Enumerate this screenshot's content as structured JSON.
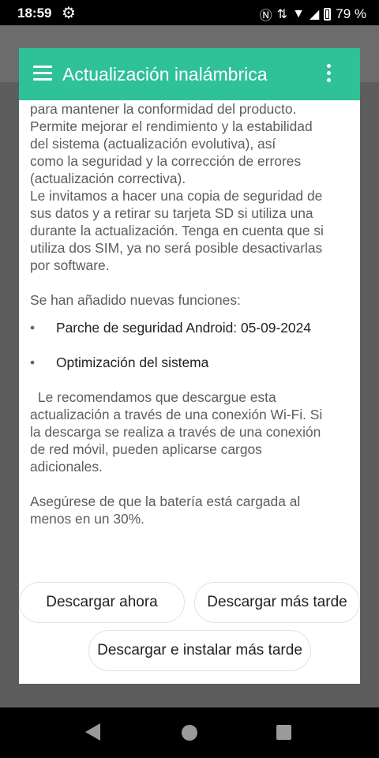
{
  "status_bar": {
    "time": "18:59",
    "battery": "79 %"
  },
  "background_app": {
    "title": ""
  },
  "dialog": {
    "title": "Actualización inalámbrica",
    "paragraphs": {
      "intro_lines": [
        "para mantener la conformidad del producto.",
        "Permite mejorar el rendimiento y la estabilidad",
        "del sistema (actualización evolutiva), así",
        "como la seguridad y la corrección de errores",
        "(actualización correctiva).",
        "Le invitamos a hacer una copia de seguridad de",
        "sus datos y a retirar su tarjeta SD si utiliza una",
        "durante la actualización. Tenga en cuenta que si",
        "utiliza dos SIM, ya no será posible desactivarlas",
        "por software."
      ],
      "features_heading": "Se han añadido nuevas funciones:",
      "features": [
        "Parche de seguridad Android: 05-09-2024",
        "Optimización del sistema"
      ],
      "recommend_lines": [
        "Le recomendamos que descargue esta",
        "actualización a través de una conexión Wi-Fi. Si",
        "la descarga se realiza a través de una conexión",
        "de red móvil, pueden aplicarse cargos",
        "adicionales."
      ],
      "battery_lines": [
        "Asegúrese de que la batería está cargada al",
        "menos en un 30%."
      ]
    },
    "buttons": {
      "download_now": "Descargar ahora",
      "download_later": "Descargar más tarde",
      "download_install_later": "Descargar e instalar más tarde"
    }
  },
  "colors": {
    "header": "#2fc198",
    "text": "#5d5d5d"
  },
  "icons": {
    "settings": "gear-icon",
    "menu": "hamburger-icon",
    "more": "kebab-icon"
  }
}
